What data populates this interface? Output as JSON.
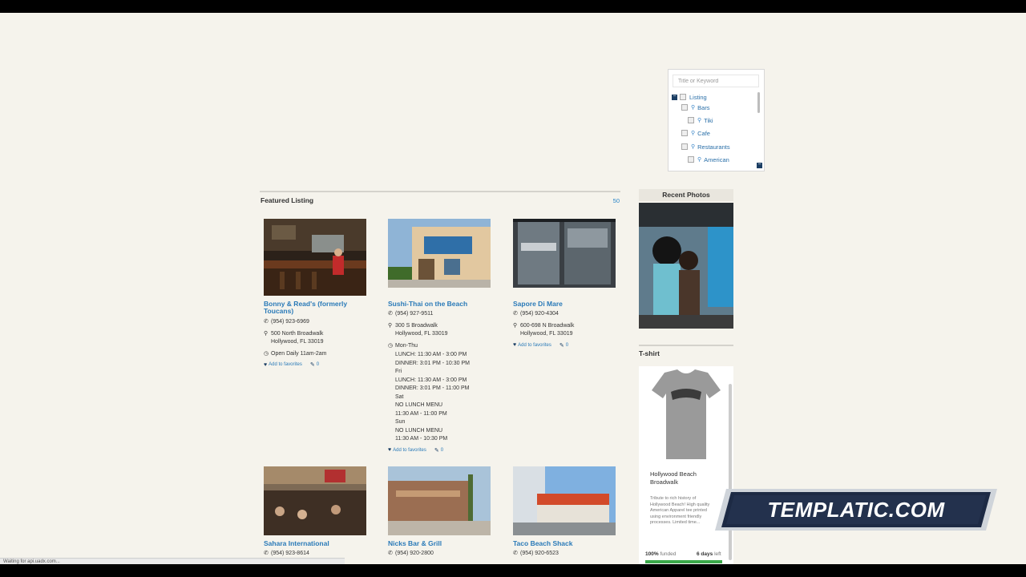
{
  "search": {
    "placeholder": "Title or Keyword",
    "tree": [
      {
        "label": "Listing",
        "toggle": "−"
      },
      {
        "label": "Bars"
      },
      {
        "label": "Tiki"
      },
      {
        "label": "Cafe"
      },
      {
        "label": "Restaurants"
      },
      {
        "label": "American"
      }
    ],
    "collapse_icon": "−"
  },
  "featured": {
    "title": "Featured Listing",
    "count": "50"
  },
  "listings": [
    {
      "name": "Bonny & Read's (formerly Toucans)",
      "phone": "(954) 923-6969",
      "address": "500 North Broadwalk\nHollywood, FL 33019",
      "hours": "Open Daily 11am-2am",
      "favorites": "Add to favorites",
      "comments": "0"
    },
    {
      "name": "Sushi-Thai on the Beach",
      "phone": "(954) 927-9511",
      "address": "300 S Broadwalk\nHollywood, FL 33019",
      "hours_label": "Mon-Thu",
      "hours": "LUNCH: 11:30 AM - 3:00 PM\nDINNER: 3:01 PM - 10:30 PM\nFri\nLUNCH: 11:30 AM - 3:00 PM\nDINNER: 3:01 PM - 11:00 PM\nSat\nNO LUNCH MENU\n11:30 AM - 11:00 PM\nSun\nNO LUNCH MENU\n11:30 AM - 10:30 PM",
      "favorites": "Add to favorites",
      "comments": "0"
    },
    {
      "name": "Sapore Di Mare",
      "phone": "(954) 920-4304",
      "address": "600-698 N Broadwalk\nHollywood, FL 33019",
      "favorites": "Add to favorites",
      "comments": "0"
    },
    {
      "name": "Sahara International",
      "phone": "(954) 923-8614"
    },
    {
      "name": "Nicks Bar & Grill",
      "phone": "(954) 920-2800"
    },
    {
      "name": "Taco Beach Shack",
      "phone": "(954) 920-6523"
    }
  ],
  "sidebar": {
    "recent_photos_title": "Recent Photos",
    "tshirt_title": "T-shirt",
    "tshirt_name": "Hollywood Beach Broadwalk",
    "tshirt_desc": "Tribute to rich history of Hollywood Beach! High quality American Apparel tee printed using environment friendly processes. Limited time...",
    "funded_pct": "100%",
    "funded_label": "funded",
    "days": "6 days",
    "days_label": "left",
    "funded_fraction": 1.0
  },
  "banner": {
    "text": "TEMPLATIC.COM"
  },
  "status": {
    "text": "Waiting for api.uadx.com..."
  },
  "icons": {
    "phone": "phone-icon",
    "pin": "map-pin-icon",
    "clock": "clock-icon",
    "heart": "heart-icon",
    "comment": "comment-icon"
  }
}
